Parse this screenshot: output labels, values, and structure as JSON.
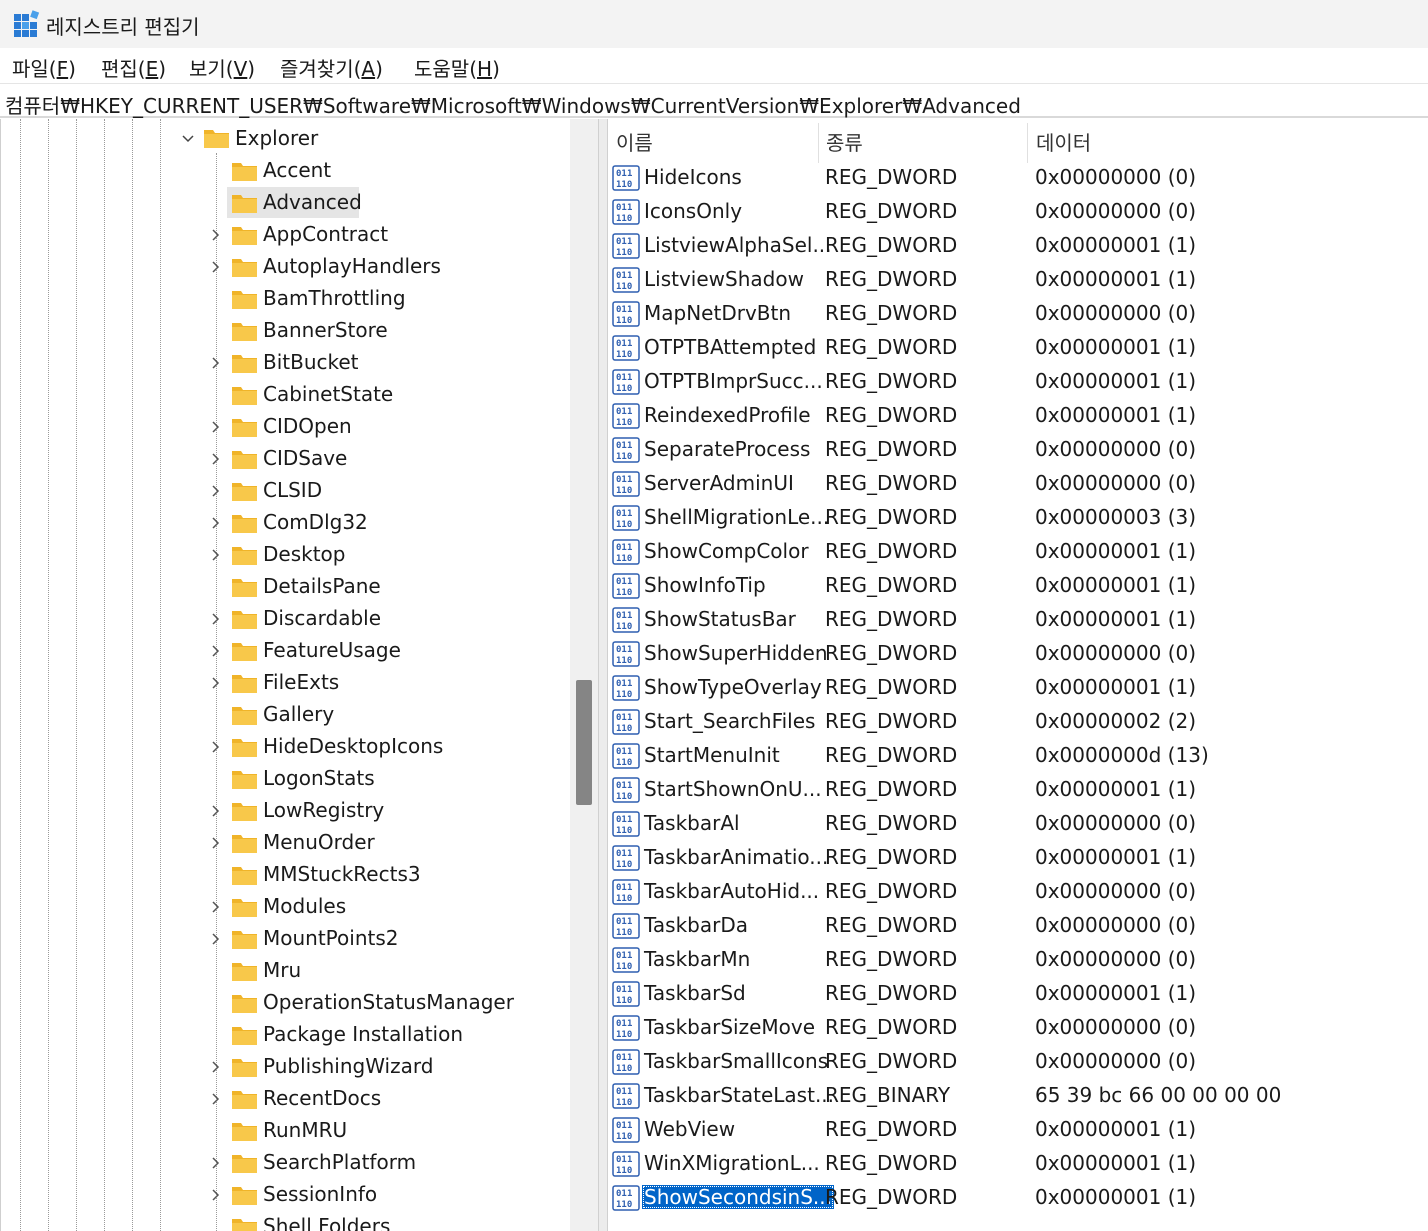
{
  "window": {
    "title": "레지스트리 편집기"
  },
  "menu": [
    {
      "label": "파일(",
      "key": "F",
      "tail": ")"
    },
    {
      "label": "편집(",
      "key": "E",
      "tail": ")"
    },
    {
      "label": "보기(",
      "key": "V",
      "tail": ")"
    },
    {
      "label": "즐겨찾기(",
      "key": "A",
      "tail": ")"
    },
    {
      "label": "도움말(",
      "key": "H",
      "tail": ")"
    }
  ],
  "address": {
    "path": "컴퓨터₩HKEY_CURRENT_USER₩Software₩Microsoft₩Windows₩CurrentVersion₩Explorer₩Advanced"
  },
  "tree": {
    "parent": {
      "label": "Explorer",
      "expanded": true
    },
    "children": [
      {
        "label": "Accent",
        "expandable": false
      },
      {
        "label": "Advanced",
        "expandable": false,
        "selected": true
      },
      {
        "label": "AppContract",
        "expandable": true
      },
      {
        "label": "AutoplayHandlers",
        "expandable": true
      },
      {
        "label": "BamThrottling",
        "expandable": false
      },
      {
        "label": "BannerStore",
        "expandable": false
      },
      {
        "label": "BitBucket",
        "expandable": true
      },
      {
        "label": "CabinetState",
        "expandable": false
      },
      {
        "label": "CIDOpen",
        "expandable": true
      },
      {
        "label": "CIDSave",
        "expandable": true
      },
      {
        "label": "CLSID",
        "expandable": true
      },
      {
        "label": "ComDlg32",
        "expandable": true
      },
      {
        "label": "Desktop",
        "expandable": true
      },
      {
        "label": "DetailsPane",
        "expandable": false
      },
      {
        "label": "Discardable",
        "expandable": true
      },
      {
        "label": "FeatureUsage",
        "expandable": true
      },
      {
        "label": "FileExts",
        "expandable": true
      },
      {
        "label": "Gallery",
        "expandable": false
      },
      {
        "label": "HideDesktopIcons",
        "expandable": true
      },
      {
        "label": "LogonStats",
        "expandable": false
      },
      {
        "label": "LowRegistry",
        "expandable": true
      },
      {
        "label": "MenuOrder",
        "expandable": true
      },
      {
        "label": "MMStuckRects3",
        "expandable": false
      },
      {
        "label": "Modules",
        "expandable": true
      },
      {
        "label": "MountPoints2",
        "expandable": true
      },
      {
        "label": "Mru",
        "expandable": false
      },
      {
        "label": "OperationStatusManager",
        "expandable": false
      },
      {
        "label": "Package Installation",
        "expandable": false
      },
      {
        "label": "PublishingWizard",
        "expandable": true
      },
      {
        "label": "RecentDocs",
        "expandable": true
      },
      {
        "label": "RunMRU",
        "expandable": false
      },
      {
        "label": "SearchPlatform",
        "expandable": true
      },
      {
        "label": "SessionInfo",
        "expandable": true
      },
      {
        "label": "Shell Folders",
        "expandable": false
      }
    ]
  },
  "list": {
    "columns": [
      "이름",
      "종류",
      "데이터"
    ],
    "rows": [
      {
        "name": "HideIcons",
        "type": "REG_DWORD",
        "data": "0x00000000 (0)"
      },
      {
        "name": "IconsOnly",
        "type": "REG_DWORD",
        "data": "0x00000000 (0)"
      },
      {
        "name": "ListviewAlphaSel...",
        "type": "REG_DWORD",
        "data": "0x00000001 (1)"
      },
      {
        "name": "ListviewShadow",
        "type": "REG_DWORD",
        "data": "0x00000001 (1)"
      },
      {
        "name": "MapNetDrvBtn",
        "type": "REG_DWORD",
        "data": "0x00000000 (0)"
      },
      {
        "name": "OTPTBAttempted",
        "type": "REG_DWORD",
        "data": "0x00000001 (1)"
      },
      {
        "name": "OTPTBImprSucc...",
        "type": "REG_DWORD",
        "data": "0x00000001 (1)"
      },
      {
        "name": "ReindexedProfile",
        "type": "REG_DWORD",
        "data": "0x00000001 (1)"
      },
      {
        "name": "SeparateProcess",
        "type": "REG_DWORD",
        "data": "0x00000000 (0)"
      },
      {
        "name": "ServerAdminUI",
        "type": "REG_DWORD",
        "data": "0x00000000 (0)"
      },
      {
        "name": "ShellMigrationLe...",
        "type": "REG_DWORD",
        "data": "0x00000003 (3)"
      },
      {
        "name": "ShowCompColor",
        "type": "REG_DWORD",
        "data": "0x00000001 (1)"
      },
      {
        "name": "ShowInfoTip",
        "type": "REG_DWORD",
        "data": "0x00000001 (1)"
      },
      {
        "name": "ShowStatusBar",
        "type": "REG_DWORD",
        "data": "0x00000001 (1)"
      },
      {
        "name": "ShowSuperHidden",
        "type": "REG_DWORD",
        "data": "0x00000000 (0)"
      },
      {
        "name": "ShowTypeOverlay",
        "type": "REG_DWORD",
        "data": "0x00000001 (1)"
      },
      {
        "name": "Start_SearchFiles",
        "type": "REG_DWORD",
        "data": "0x00000002 (2)"
      },
      {
        "name": "StartMenuInit",
        "type": "REG_DWORD",
        "data": "0x0000000d (13)"
      },
      {
        "name": "StartShownOnU...",
        "type": "REG_DWORD",
        "data": "0x00000001 (1)"
      },
      {
        "name": "TaskbarAl",
        "type": "REG_DWORD",
        "data": "0x00000000 (0)"
      },
      {
        "name": "TaskbarAnimatio...",
        "type": "REG_DWORD",
        "data": "0x00000001 (1)"
      },
      {
        "name": "TaskbarAutoHid...",
        "type": "REG_DWORD",
        "data": "0x00000000 (0)"
      },
      {
        "name": "TaskbarDa",
        "type": "REG_DWORD",
        "data": "0x00000000 (0)"
      },
      {
        "name": "TaskbarMn",
        "type": "REG_DWORD",
        "data": "0x00000000 (0)"
      },
      {
        "name": "TaskbarSd",
        "type": "REG_DWORD",
        "data": "0x00000001 (1)"
      },
      {
        "name": "TaskbarSizeMove",
        "type": "REG_DWORD",
        "data": "0x00000000 (0)"
      },
      {
        "name": "TaskbarSmallIcons",
        "type": "REG_DWORD",
        "data": "0x00000000 (0)"
      },
      {
        "name": "TaskbarStateLast...",
        "type": "REG_BINARY",
        "data": "65 39 bc 66 00 00 00 00"
      },
      {
        "name": "WebView",
        "type": "REG_DWORD",
        "data": "0x00000001 (1)"
      },
      {
        "name": "WinXMigrationL...",
        "type": "REG_DWORD",
        "data": "0x00000001 (1)"
      },
      {
        "name": "ShowSecondsinS...",
        "type": "REG_DWORD",
        "data": "0x00000001 (1)",
        "selected": true
      }
    ]
  },
  "colors": {
    "selection": "#0064c8",
    "folder": "#f8c84a",
    "tree_selection": "#e5e5e5"
  },
  "icons": {
    "app": "registry-editor-icon",
    "folder": "folder-icon",
    "value": "reg-dword-icon",
    "expand": "chevron-right-icon",
    "collapse": "chevron-down-icon"
  }
}
